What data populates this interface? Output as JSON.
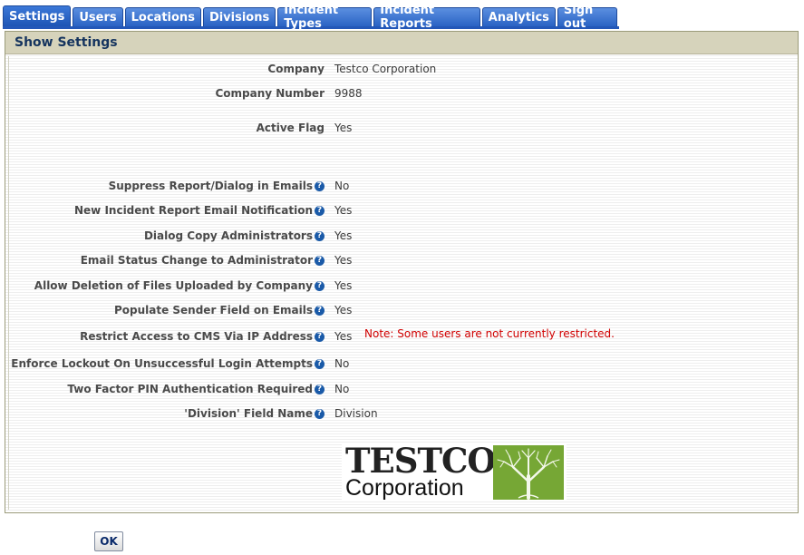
{
  "tabs": [
    "Settings",
    "Users",
    "Locations",
    "Divisions",
    "Incident Types",
    "Incident Reports",
    "Analytics",
    "Sign out"
  ],
  "panel": {
    "title": "Show Settings"
  },
  "settings": [
    {
      "label": "Company",
      "value": "Testco Corporation",
      "help": false
    },
    {
      "label": "Company Number",
      "value": "9988",
      "help": false
    },
    {
      "label": "Active Flag",
      "value": "Yes",
      "help": false
    },
    {
      "label": "Suppress Report/Dialog in Emails",
      "value": "No",
      "help": true
    },
    {
      "label": "New Incident Report Email Notification",
      "value": "Yes",
      "help": true
    },
    {
      "label": "Dialog Copy Administrators",
      "value": "Yes",
      "help": true
    },
    {
      "label": "Email Status Change to Administrator",
      "value": "Yes",
      "help": true
    },
    {
      "label": "Allow Deletion of Files Uploaded by Company",
      "value": "Yes",
      "help": true
    },
    {
      "label": "Populate Sender Field on Emails",
      "value": "Yes",
      "help": true
    },
    {
      "label": "Restrict Access to CMS Via IP Address",
      "value": "Yes",
      "help": true,
      "note": "Note: Some users are not currently restricted."
    },
    {
      "label": "Enforce Lockout On Unsuccessful Login Attempts",
      "value": "No",
      "help": true
    },
    {
      "label": "Two Factor PIN Authentication Required",
      "value": "No",
      "help": true
    },
    {
      "label": "'Division' Field Name",
      "value": "Division",
      "help": true
    }
  ],
  "logo": {
    "line1": "TESTCO",
    "line2": "Corporation"
  },
  "ok_label": "OK",
  "help_glyph": "?",
  "colors": {
    "tab": "#2a63c4",
    "note": "#d00000",
    "header_bg": "#d6d3bb",
    "logo_green": "#6a9a2a"
  }
}
